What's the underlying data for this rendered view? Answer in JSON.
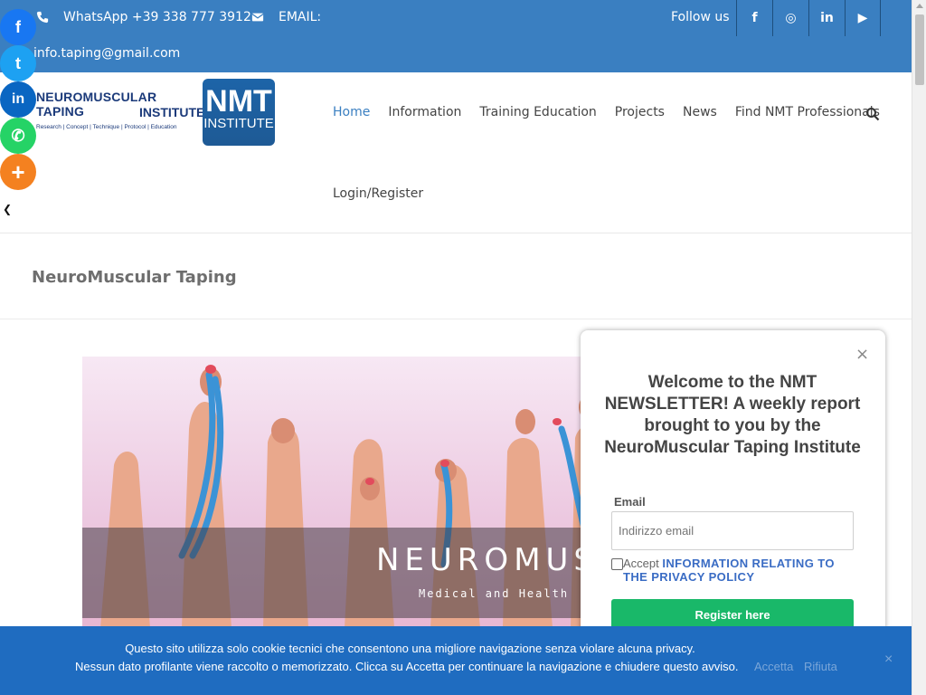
{
  "topbar": {
    "phone": "WhatsApp +39 338 777 3912",
    "email_label": "EMAIL:",
    "email_address": "info.taping@gmail.com",
    "follow": "Follow us",
    "social": [
      {
        "icon": "facebook-icon",
        "glyph": "f"
      },
      {
        "icon": "instagram-icon",
        "glyph": "◎"
      },
      {
        "icon": "linkedin-icon",
        "glyph": "in"
      },
      {
        "icon": "youtube-icon",
        "glyph": "▶"
      }
    ],
    "background": "#3a7fc1"
  },
  "share_bar": {
    "facebook": "f",
    "twitter": "t",
    "linkedin": "in",
    "whatsapp": "✆",
    "more": "+",
    "hide": "❮"
  },
  "logo": {
    "line1": "NEUROMUSCULAR TAPING",
    "line2": "INSTITUTE",
    "tagline": "Research | Concept | Technique | Protocol | Education",
    "badge_top": "NMT",
    "badge_bottom": "INSTITUTE"
  },
  "nav": {
    "items": [
      "Home",
      "Information",
      "Training Education",
      "Projects",
      "News",
      "Find NMT Professionals"
    ],
    "active": "Home",
    "login": "Login/Register",
    "accent": "#3a7fc1"
  },
  "page": {
    "title": "NeuroMuscular Taping"
  },
  "hero": {
    "word": "NEUROMUSCU",
    "subtitle": "Medical and Health"
  },
  "newsletter": {
    "close": "×",
    "heading": "Welcome to the NMT NEWSLETTER! A weekly report brought to you by the NeuroMuscular Taping Institute",
    "email_label": "Email",
    "email_placeholder": "Indirizzo email",
    "accept": "Accept",
    "policy_link": "INFORMATION RELATING TO THE PRIVACY POLICY",
    "button": "Register here",
    "button_color": "#19b869"
  },
  "cookie": {
    "line1": "Questo sito utilizza solo cookie tecnici che consentono una migliore navigazione senza violare alcuna privacy.",
    "line2": "Nessun dato profilante viene raccolto o memorizzato. Clicca su Accetta per continuare la navigazione e chiudere questo avviso.",
    "accept": "Accetta",
    "refuse": "Rifiuta",
    "close": "×",
    "background": "#1f6cc0"
  }
}
